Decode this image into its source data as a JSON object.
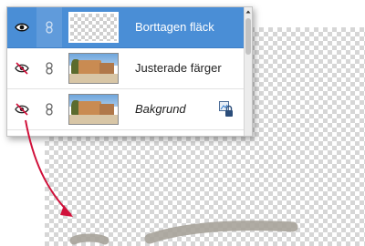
{
  "colors": {
    "selection": "#4a8ed6",
    "arrow": "#d0103a",
    "stroke": "#a7a39a"
  },
  "layers": [
    {
      "name": "Borttagen fläck",
      "visible": true,
      "selected": true,
      "thumbnail": "transparent",
      "italic": false
    },
    {
      "name": "Justerade färger",
      "visible": false,
      "selected": false,
      "thumbnail": "photo",
      "italic": false
    },
    {
      "name": "Bakgrund",
      "visible": false,
      "selected": false,
      "thumbnail": "photo",
      "italic": true,
      "locked": true
    }
  ],
  "icons": {
    "visible": "eye-icon",
    "hidden": "eye-hidden-icon",
    "link": "chain-link-icon",
    "lock": "locked-layer-icon"
  }
}
